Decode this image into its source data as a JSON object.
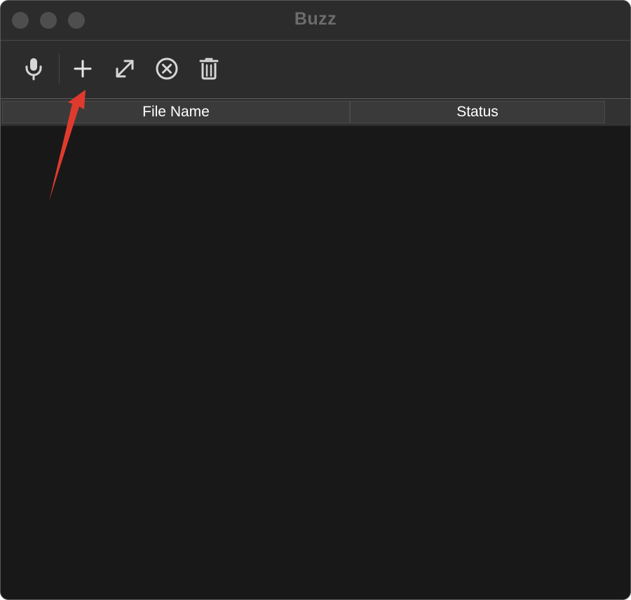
{
  "window": {
    "title": "Buzz",
    "traffic_lights": [
      "close",
      "minimize",
      "zoom"
    ]
  },
  "toolbar": {
    "buttons": [
      {
        "icon": "microphone-icon",
        "action": "record"
      },
      {
        "icon": "plus-icon",
        "action": "add"
      },
      {
        "icon": "expand-icon",
        "action": "open"
      },
      {
        "icon": "circle-x-icon",
        "action": "stop"
      },
      {
        "icon": "trash-icon",
        "action": "delete"
      }
    ]
  },
  "table": {
    "columns": [
      "File Name",
      "Status"
    ],
    "rows": []
  },
  "colors": {
    "titlebar": "#2c2c2c",
    "table_background": "#181818",
    "header_text": "#ffffff",
    "icon": "#d6d6d6",
    "annotation_arrow": "#e03a2e"
  }
}
